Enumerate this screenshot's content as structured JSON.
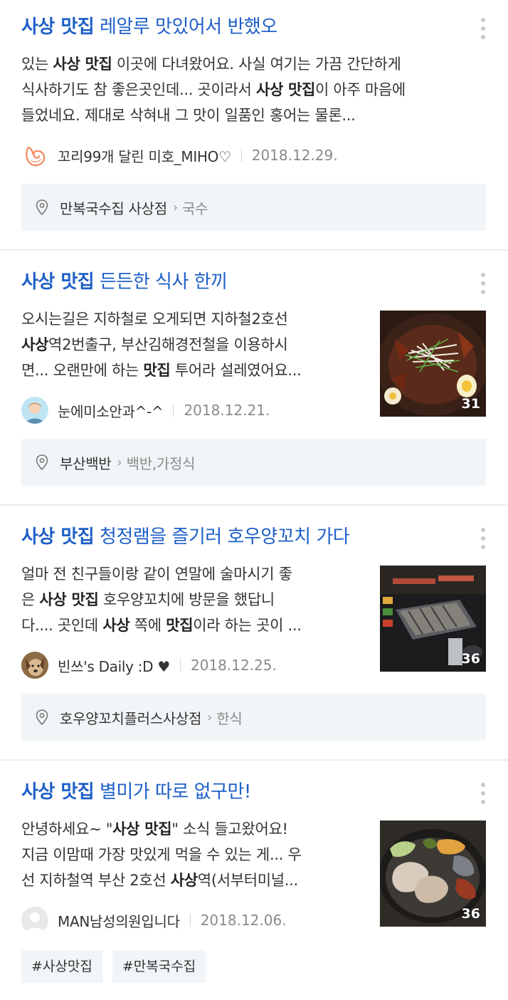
{
  "results": [
    {
      "title_keyword": "사상 맛집",
      "title_rest": " 레알루 맛있어서 반했오",
      "snippet_lines": [
        [
          {
            "t": "있는 ",
            "b": false
          },
          {
            "t": "사상 맛집",
            "b": true
          },
          {
            "t": " 이곳에 다녀왔어요. 사실 여기는 가끔 간단하게",
            "b": false
          }
        ],
        [
          {
            "t": "식사하기도 참 좋은곳인데... 곳이라서 ",
            "b": false
          },
          {
            "t": "사상 맛집",
            "b": true
          },
          {
            "t": "이 아주 마음에",
            "b": false
          }
        ],
        [
          {
            "t": "들었네요. 제대로 삭혀내 그 맛이 일품인 홍어는 물론...",
            "b": false
          }
        ]
      ],
      "author": "꼬리99개 달린 미호_MIHO♡",
      "date": "2018.12.29.",
      "place_name": "만복국수집 사상점",
      "place_category": "국수",
      "avatar_icon": "fox-logo-icon",
      "photo_count": null
    },
    {
      "title_keyword": "사상 맛집",
      "title_rest": " 든든한 식사 한끼",
      "snippet_lines": [
        [
          {
            "t": "오시는길은 지하철로 오게되면 지하철2호선",
            "b": false
          }
        ],
        [
          {
            "t": "사상",
            "b": true
          },
          {
            "t": "역2번출구, 부산김해경전철을 이용하시",
            "b": false
          }
        ],
        [
          {
            "t": "면... 오랜만에 하는 ",
            "b": false
          },
          {
            "t": "맛집",
            "b": true
          },
          {
            "t": " 투어라 설레였어요...",
            "b": false
          }
        ]
      ],
      "author": "눈에미소안과^-^",
      "date": "2018.12.21.",
      "place_name": "부산백반",
      "place_category": "백반,가정식",
      "avatar_icon": "person-avatar-icon",
      "photo_count": "31"
    },
    {
      "title_keyword": "사상 맛집",
      "title_rest": " 청정램을 즐기러 호우양꼬치 가다",
      "snippet_lines": [
        [
          {
            "t": "얼마 전 친구들이랑 같이 연말에 술마시기 좋",
            "b": false
          }
        ],
        [
          {
            "t": "은 ",
            "b": false
          },
          {
            "t": "사상 맛집",
            "b": true
          },
          {
            "t": " 호우양꼬치에 방문을 했답니",
            "b": false
          }
        ],
        [
          {
            "t": "다.... 곳인데 ",
            "b": false
          },
          {
            "t": "사상",
            "b": true
          },
          {
            "t": " 쪽에 ",
            "b": false
          },
          {
            "t": "맛집",
            "b": true
          },
          {
            "t": "이라 하는 곳이 ...",
            "b": false
          }
        ]
      ],
      "author": "빈쓰's Daily :D ♥",
      "date": "2018.12.25.",
      "place_name": "호우양꼬치플러스사상점",
      "place_category": "한식",
      "avatar_icon": "dog-avatar-icon",
      "photo_count": "36"
    },
    {
      "title_keyword": "사상 맛집",
      "title_rest": " 별미가 따로 없구만!",
      "snippet_lines": [
        [
          {
            "t": "안녕하세요~ \"",
            "b": false
          },
          {
            "t": "사상 맛집",
            "b": true
          },
          {
            "t": "\" 소식 들고왔어요!",
            "b": false
          }
        ],
        [
          {
            "t": "지금 이맘때 가장 맛있게 먹을 수 있는 게... 우",
            "b": false
          }
        ],
        [
          {
            "t": "선 지하철역 부산 2호선 ",
            "b": false
          },
          {
            "t": "사상",
            "b": true
          },
          {
            "t": "역(서부터미널...",
            "b": false
          }
        ]
      ],
      "author": "MAN남성의원입니다",
      "date": "2018.12.06.",
      "tags": [
        "#사상맛집",
        "#만복국수집"
      ],
      "avatar_icon": "default-avatar-icon",
      "photo_count": "36"
    }
  ],
  "colors": {
    "title": "#1d5fc7",
    "place_bg": "#f2f5f7",
    "date": "#8a8a8a"
  }
}
